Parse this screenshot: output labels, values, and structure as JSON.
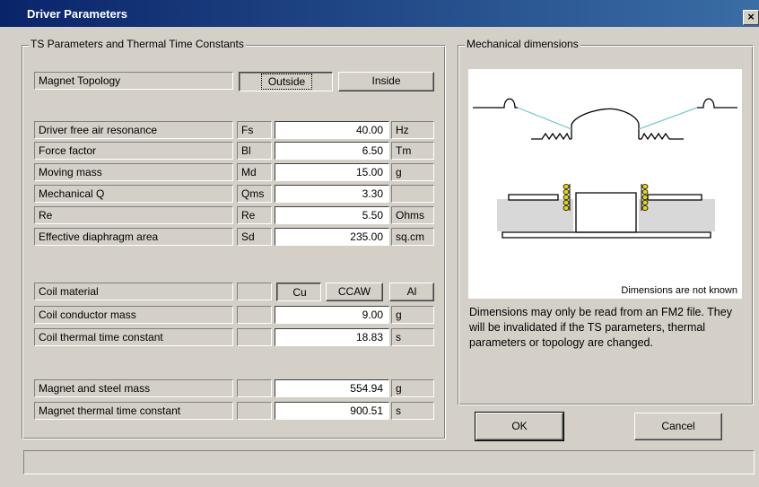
{
  "window": {
    "title": "Driver Parameters",
    "close_label": "×"
  },
  "ts_group": {
    "legend": "TS Parameters and Thermal Time Constants"
  },
  "topology": {
    "label": "Magnet Topology",
    "outside": "Outside",
    "inside": "Inside"
  },
  "ts_params": [
    {
      "label": "Driver free air resonance",
      "symbol": "Fs",
      "value": "40.00",
      "unit": "Hz"
    },
    {
      "label": "Force factor",
      "symbol": "Bl",
      "value": "6.50",
      "unit": "Tm"
    },
    {
      "label": "Moving mass",
      "symbol": "Md",
      "value": "15.00",
      "unit": "g"
    },
    {
      "label": "Mechanical Q",
      "symbol": "Qms",
      "value": "3.30",
      "unit": ""
    },
    {
      "label": "Re",
      "symbol": "Re",
      "value": "5.50",
      "unit": "Ohms"
    },
    {
      "label": "Effective diaphragm area",
      "symbol": "Sd",
      "value": "235.00",
      "unit": "sq.cm"
    }
  ],
  "coil": {
    "material_label": "Coil material",
    "cu": "Cu",
    "ccaw": "CCAW",
    "al": "Al",
    "rows": [
      {
        "label": "Coil conductor mass",
        "value": "9.00",
        "unit": "g"
      },
      {
        "label": "Coil thermal time constant",
        "value": "18.83",
        "unit": "s"
      }
    ]
  },
  "magnet": {
    "rows": [
      {
        "label": "Magnet and steel mass",
        "value": "554.94",
        "unit": "g"
      },
      {
        "label": "Magnet thermal time constant",
        "value": "900.51",
        "unit": "s"
      }
    ]
  },
  "mech_group": {
    "legend": "Mechanical dimensions",
    "diagram_caption": "Dimensions are not known",
    "note": "Dimensions may only be read from an FM2 file. They will be invalidated if the TS parameters, thermal parameters or topology are changed."
  },
  "buttons": {
    "ok": "OK",
    "cancel": "Cancel"
  },
  "status": {
    "text": ""
  },
  "colors": {
    "title_start": "#0a246a",
    "title_end": "#3a6ea5",
    "dialog_bg": "#d4d0c8",
    "suspension_line": "#6fc9c9",
    "coil": "#e8d800"
  }
}
